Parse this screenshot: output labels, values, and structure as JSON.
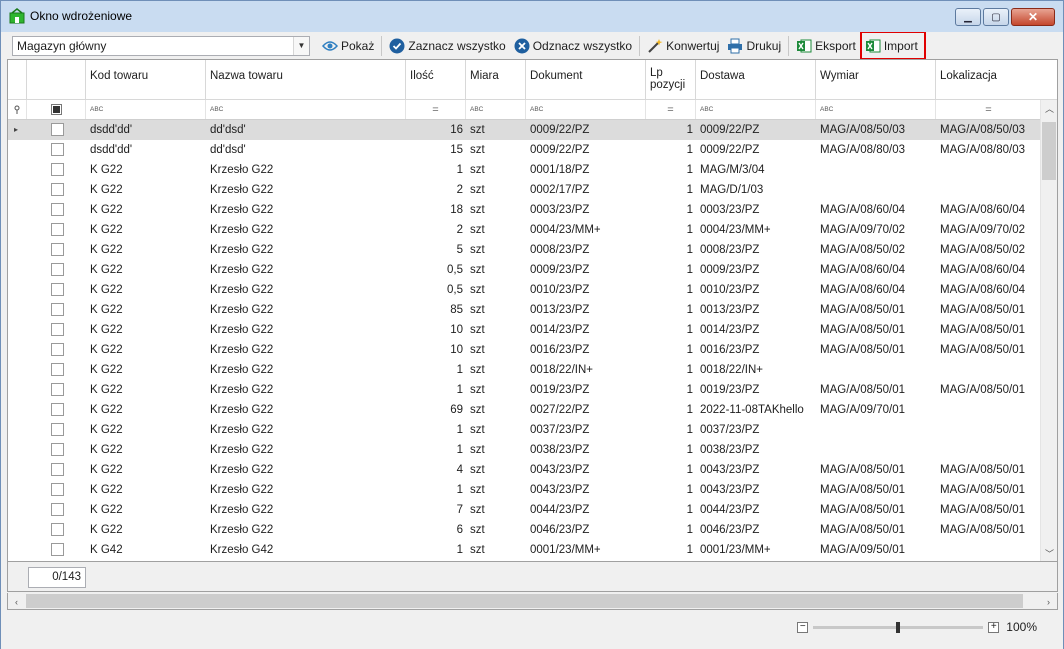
{
  "window": {
    "title": "Okno wdrożeniowe",
    "controls": [
      "minimize",
      "maximize",
      "close"
    ]
  },
  "toolbar": {
    "warehouse": "Magazyn główny",
    "buttons": [
      {
        "name": "show-button",
        "icon": "eye-icon",
        "label": "Pokaż"
      },
      {
        "name": "select-all-button",
        "icon": "check-circle-icon",
        "label": "Zaznacz wszystko"
      },
      {
        "name": "deselect-all-button",
        "icon": "x-circle-icon",
        "label": "Odznacz wszystko"
      },
      {
        "name": "convert-button",
        "icon": "magic-wand-icon",
        "label": "Konwertuj"
      },
      {
        "name": "print-button",
        "icon": "printer-icon",
        "label": "Drukuj"
      },
      {
        "name": "export-button",
        "icon": "excel-icon",
        "label": "Eksport"
      },
      {
        "name": "import-button",
        "icon": "excel-icon",
        "label": "Import"
      }
    ],
    "highlight_color": "#e00000"
  },
  "grid": {
    "columns": [
      {
        "key": "kod",
        "label": "Kod towaru",
        "filter": "text"
      },
      {
        "key": "nazwa",
        "label": "Nazwa towaru",
        "filter": "text"
      },
      {
        "key": "ilosc",
        "label": "Ilość",
        "filter": "numeric"
      },
      {
        "key": "miara",
        "label": "Miara",
        "filter": "text"
      },
      {
        "key": "dokument",
        "label": "Dokument",
        "filter": "text"
      },
      {
        "key": "lp",
        "label": "Lp pozycji",
        "filter": "numeric"
      },
      {
        "key": "dostawa",
        "label": "Dostawa",
        "filter": "text"
      },
      {
        "key": "wymiar",
        "label": "Wymiar",
        "filter": "text"
      },
      {
        "key": "lokalizacja",
        "label": "Lokalizacja",
        "filter": "numeric"
      }
    ],
    "filter_text_symbol": "ABC",
    "filter_numeric_symbol": "=",
    "rows": [
      {
        "kod": "dsdd'dd'",
        "nazwa": "dd'dsd'",
        "ilosc": "16",
        "miara": "szt",
        "dokument": "0009/22/PZ",
        "lp": "1",
        "dostawa": "0009/22/PZ",
        "wymiar": "MAG/A/08/50/03",
        "lokalizacja": "MAG/A/08/50/03",
        "selected": true
      },
      {
        "kod": "dsdd'dd'",
        "nazwa": "dd'dsd'",
        "ilosc": "15",
        "miara": "szt",
        "dokument": "0009/22/PZ",
        "lp": "1",
        "dostawa": "0009/22/PZ",
        "wymiar": "MAG/A/08/80/03",
        "lokalizacja": "MAG/A/08/80/03"
      },
      {
        "kod": "K G22",
        "nazwa": "Krzesło G22",
        "ilosc": "1",
        "miara": "szt",
        "dokument": "0001/18/PZ",
        "lp": "1",
        "dostawa": "MAG/M/3/04",
        "wymiar": "",
        "lokalizacja": ""
      },
      {
        "kod": "K G22",
        "nazwa": "Krzesło G22",
        "ilosc": "2",
        "miara": "szt",
        "dokument": "0002/17/PZ",
        "lp": "1",
        "dostawa": "MAG/D/1/03",
        "wymiar": "",
        "lokalizacja": ""
      },
      {
        "kod": "K G22",
        "nazwa": "Krzesło G22",
        "ilosc": "18",
        "miara": "szt",
        "dokument": "0003/23/PZ",
        "lp": "1",
        "dostawa": "0003/23/PZ",
        "wymiar": "MAG/A/08/60/04",
        "lokalizacja": "MAG/A/08/60/04"
      },
      {
        "kod": "K G22",
        "nazwa": "Krzesło G22",
        "ilosc": "2",
        "miara": "szt",
        "dokument": "0004/23/MM+",
        "lp": "1",
        "dostawa": "0004/23/MM+",
        "wymiar": "MAG/A/09/70/02",
        "lokalizacja": "MAG/A/09/70/02"
      },
      {
        "kod": "K G22",
        "nazwa": "Krzesło G22",
        "ilosc": "5",
        "miara": "szt",
        "dokument": "0008/23/PZ",
        "lp": "1",
        "dostawa": "0008/23/PZ",
        "wymiar": "MAG/A/08/50/02",
        "lokalizacja": "MAG/A/08/50/02"
      },
      {
        "kod": "K G22",
        "nazwa": "Krzesło G22",
        "ilosc": "0,5",
        "miara": "szt",
        "dokument": "0009/23/PZ",
        "lp": "1",
        "dostawa": "0009/23/PZ",
        "wymiar": "MAG/A/08/60/04",
        "lokalizacja": "MAG/A/08/60/04"
      },
      {
        "kod": "K G22",
        "nazwa": "Krzesło G22",
        "ilosc": "0,5",
        "miara": "szt",
        "dokument": "0010/23/PZ",
        "lp": "1",
        "dostawa": "0010/23/PZ",
        "wymiar": "MAG/A/08/60/04",
        "lokalizacja": "MAG/A/08/60/04"
      },
      {
        "kod": "K G22",
        "nazwa": "Krzesło G22",
        "ilosc": "85",
        "miara": "szt",
        "dokument": "0013/23/PZ",
        "lp": "1",
        "dostawa": "0013/23/PZ",
        "wymiar": "MAG/A/08/50/01",
        "lokalizacja": "MAG/A/08/50/01"
      },
      {
        "kod": "K G22",
        "nazwa": "Krzesło G22",
        "ilosc": "10",
        "miara": "szt",
        "dokument": "0014/23/PZ",
        "lp": "1",
        "dostawa": "0014/23/PZ",
        "wymiar": "MAG/A/08/50/01",
        "lokalizacja": "MAG/A/08/50/01"
      },
      {
        "kod": "K G22",
        "nazwa": "Krzesło G22",
        "ilosc": "10",
        "miara": "szt",
        "dokument": "0016/23/PZ",
        "lp": "1",
        "dostawa": "0016/23/PZ",
        "wymiar": "MAG/A/08/50/01",
        "lokalizacja": "MAG/A/08/50/01"
      },
      {
        "kod": "K G22",
        "nazwa": "Krzesło G22",
        "ilosc": "1",
        "miara": "szt",
        "dokument": "0018/22/IN+",
        "lp": "1",
        "dostawa": "0018/22/IN+",
        "wymiar": "",
        "lokalizacja": ""
      },
      {
        "kod": "K G22",
        "nazwa": "Krzesło G22",
        "ilosc": "1",
        "miara": "szt",
        "dokument": "0019/23/PZ",
        "lp": "1",
        "dostawa": "0019/23/PZ",
        "wymiar": "MAG/A/08/50/01",
        "lokalizacja": "MAG/A/08/50/01"
      },
      {
        "kod": "K G22",
        "nazwa": "Krzesło G22",
        "ilosc": "69",
        "miara": "szt",
        "dokument": "0027/22/PZ",
        "lp": "1",
        "dostawa": "2022-11-08TAKhello",
        "wymiar": "MAG/A/09/70/01",
        "lokalizacja": ""
      },
      {
        "kod": "K G22",
        "nazwa": "Krzesło G22",
        "ilosc": "1",
        "miara": "szt",
        "dokument": "0037/23/PZ",
        "lp": "1",
        "dostawa": "0037/23/PZ",
        "wymiar": "",
        "lokalizacja": ""
      },
      {
        "kod": "K G22",
        "nazwa": "Krzesło G22",
        "ilosc": "1",
        "miara": "szt",
        "dokument": "0038/23/PZ",
        "lp": "1",
        "dostawa": "0038/23/PZ",
        "wymiar": "",
        "lokalizacja": ""
      },
      {
        "kod": "K G22",
        "nazwa": "Krzesło G22",
        "ilosc": "4",
        "miara": "szt",
        "dokument": "0043/23/PZ",
        "lp": "1",
        "dostawa": "0043/23/PZ",
        "wymiar": "MAG/A/08/50/01",
        "lokalizacja": "MAG/A/08/50/01"
      },
      {
        "kod": "K G22",
        "nazwa": "Krzesło G22",
        "ilosc": "1",
        "miara": "szt",
        "dokument": "0043/23/PZ",
        "lp": "1",
        "dostawa": "0043/23/PZ",
        "wymiar": "MAG/A/08/50/01",
        "lokalizacja": "MAG/A/08/50/01"
      },
      {
        "kod": "K G22",
        "nazwa": "Krzesło G22",
        "ilosc": "7",
        "miara": "szt",
        "dokument": "0044/23/PZ",
        "lp": "1",
        "dostawa": "0044/23/PZ",
        "wymiar": "MAG/A/08/50/01",
        "lokalizacja": "MAG/A/08/50/01"
      },
      {
        "kod": "K G22",
        "nazwa": "Krzesło G22",
        "ilosc": "6",
        "miara": "szt",
        "dokument": "0046/23/PZ",
        "lp": "1",
        "dostawa": "0046/23/PZ",
        "wymiar": "MAG/A/08/50/01",
        "lokalizacja": "MAG/A/08/50/01"
      },
      {
        "kod": "K G42",
        "nazwa": "Krzesło G42",
        "ilosc": "1",
        "miara": "szt",
        "dokument": "0001/23/MM+",
        "lp": "1",
        "dostawa": "0001/23/MM+",
        "wymiar": "MAG/A/09/50/01",
        "lokalizacja": ""
      }
    ]
  },
  "footer": {
    "count": "0/143"
  },
  "statusbar": {
    "zoom": "100%",
    "zoom_level": 0.5
  }
}
